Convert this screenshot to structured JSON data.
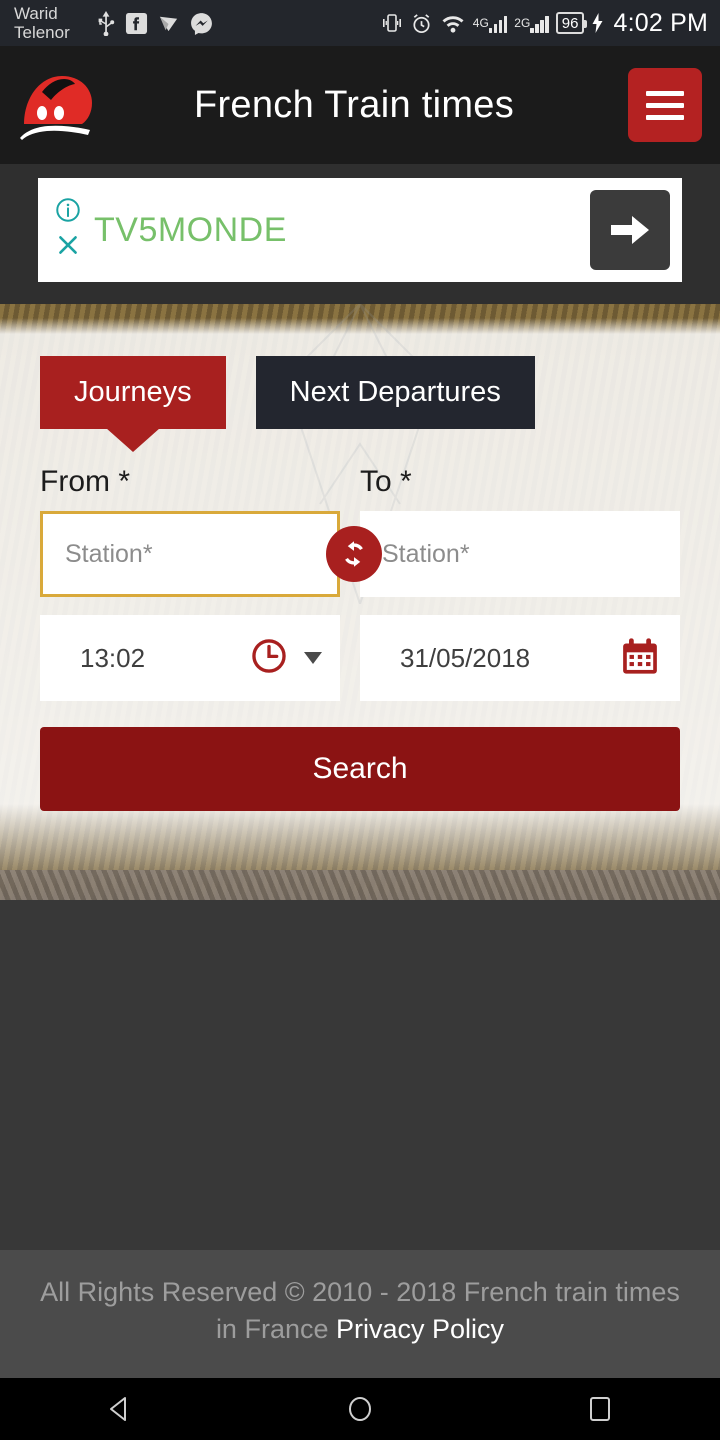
{
  "status_bar": {
    "carrier": "Warid\nTelenor",
    "left_icons": [
      "usb-icon",
      "facebook-icon",
      "play-store-icon",
      "messenger-icon"
    ],
    "right_icons": [
      "vibrate-icon",
      "alarm-icon",
      "wifi-icon",
      "signal-4g-icon",
      "signal-2g-icon",
      "battery-icon",
      "charging-bolt-icon"
    ],
    "network_1_label": "4G",
    "network_2_label": "2G",
    "battery_level": "96",
    "clock": "4:02 PM"
  },
  "header": {
    "title": "French Train times",
    "logo_icon": "train-logo-icon",
    "menu_icon": "hamburger-menu-icon",
    "menu_color": "#b42222"
  },
  "ad": {
    "info_icon": "ad-info-icon",
    "close_icon": "ad-close-icon",
    "advertiser": "TV5MONDE",
    "advertiser_color": "#77c06a",
    "arrow_icon": "arrow-right-icon"
  },
  "form": {
    "tabs": [
      {
        "label": "Journeys",
        "active": true,
        "color": "#a8201f"
      },
      {
        "label": "Next Departures",
        "active": false,
        "color": "#23262f"
      }
    ],
    "from_label": "From *",
    "to_label": "To *",
    "from_placeholder": "Station*",
    "from_value": "",
    "to_placeholder": "Station*",
    "to_value": "",
    "swap_icon": "swap-stations-icon",
    "time_value": "13:02",
    "time_icon": "clock-icon",
    "time_caret_icon": "chevron-down-icon",
    "date_value": "31/05/2018",
    "date_icon": "calendar-icon",
    "search_label": "Search",
    "search_color": "#8b1313",
    "focus_border_color": "#d9a93a"
  },
  "footer": {
    "copyright": "All Rights Reserved © 2010 - 2018 French train times in France ",
    "privacy_label": "Privacy Policy"
  },
  "nav_bar": {
    "back_icon": "back-triangle-icon",
    "home_icon": "home-circle-icon",
    "recents_icon": "recents-square-icon"
  }
}
